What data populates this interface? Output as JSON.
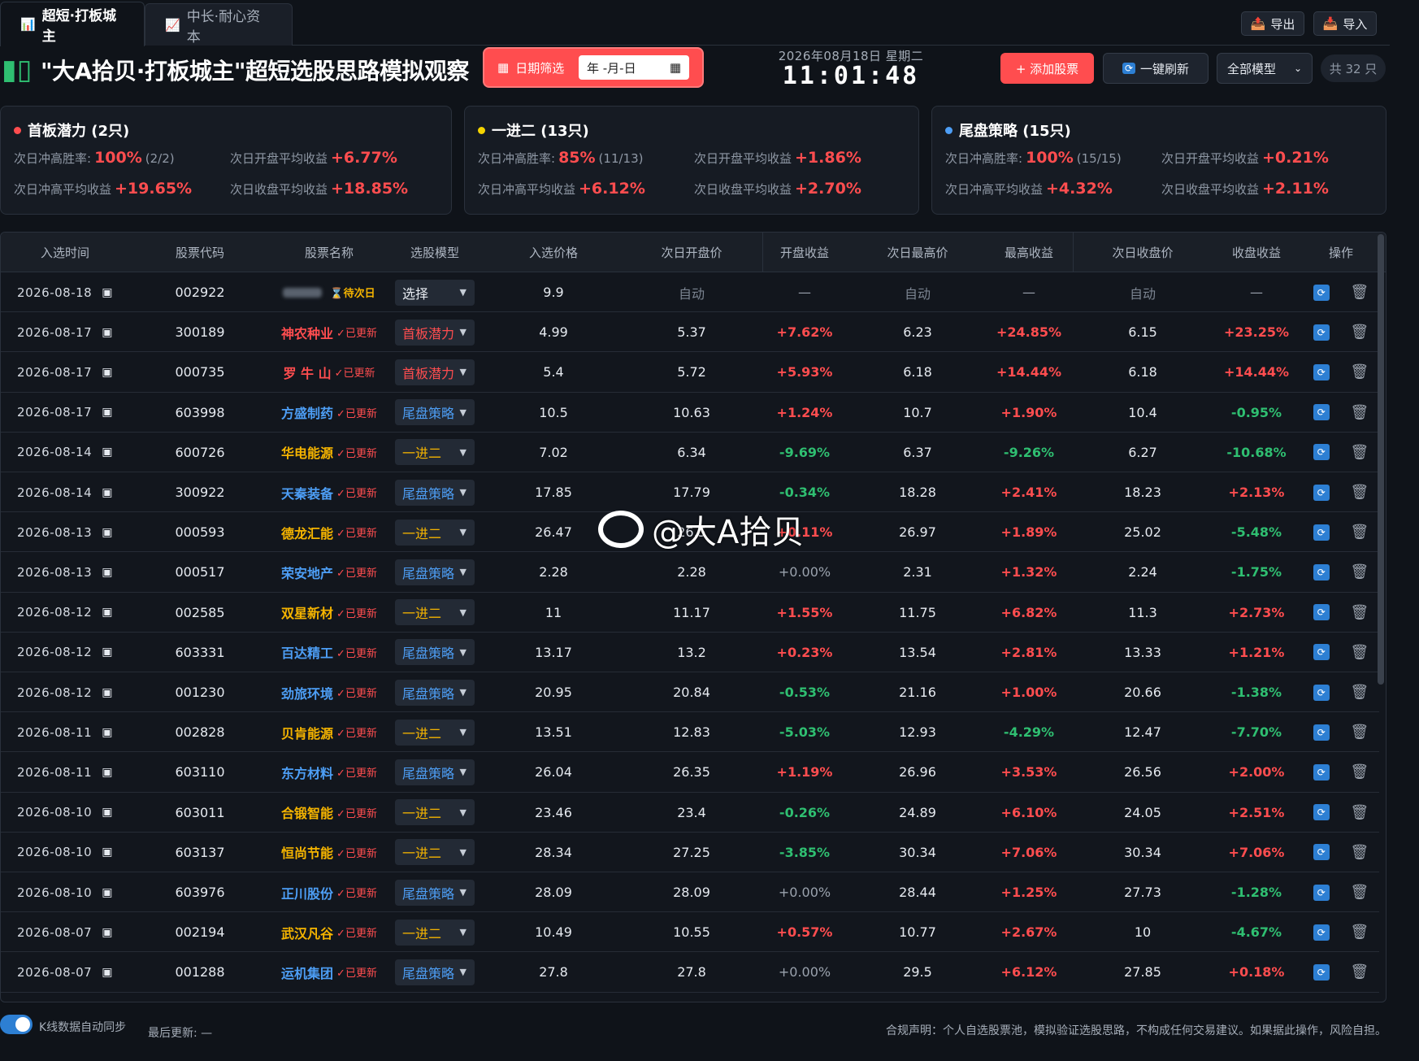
{
  "tabs": {
    "active": "超短·打板城主",
    "inactive": "中长·耐心资本"
  },
  "header_buttons": {
    "export": "导出",
    "import": "导入"
  },
  "page_title": "\"大A拾贝·打板城主\"超短选股思路模拟观察",
  "date_filter": {
    "label": "日期筛选",
    "value": "年 -月-日"
  },
  "clock": {
    "date": "2026年08月18日 星期二",
    "time": "11:01:48"
  },
  "actions": {
    "add": "+ 添加股票",
    "refresh": "一键刷新",
    "model_select": "全部模型",
    "count": "共 32 只"
  },
  "cards": [
    {
      "title": "首板潜力 (2只)",
      "color": "#ff4d4f",
      "rate_label": "次日冲高胜率:",
      "rate": "100%",
      "rate_sub": "(2/2)",
      "open_label": "次日开盘平均收益",
      "open": "+6.77%",
      "high_label": "次日冲高平均收益",
      "high": "+19.65%",
      "close_label": "次日收盘平均收益",
      "close": "+18.85%"
    },
    {
      "title": "一进二 (13只)",
      "color": "#f5d400",
      "rate_label": "次日冲高胜率:",
      "rate": "85%",
      "rate_sub": "(11/13)",
      "open_label": "次日开盘平均收益",
      "open": "+1.86%",
      "high_label": "次日冲高平均收益",
      "high": "+6.12%",
      "close_label": "次日收盘平均收益",
      "close": "+2.70%"
    },
    {
      "title": "尾盘策略 (15只)",
      "color": "#4d9ef5",
      "rate_label": "次日冲高胜率:",
      "rate": "100%",
      "rate_sub": "(15/15)",
      "open_label": "次日开盘平均收益",
      "open": "+0.21%",
      "high_label": "次日冲高平均收益",
      "high": "+4.32%",
      "close_label": "次日收盘平均收益",
      "close": "+2.11%"
    }
  ],
  "table": {
    "headers": [
      "入选时间",
      "股票代码",
      "股票名称",
      "选股模型",
      "入选价格",
      "次日开盘价",
      "开盘收益",
      "次日最高价",
      "最高收益",
      "次日收盘价",
      "收盘收益",
      "操作"
    ],
    "rows": [
      {
        "date": "2026-08-18",
        "code": "002922",
        "name": "",
        "status": "⌛待次日",
        "model": "选择",
        "price": "9.9",
        "open": "自动",
        "open_ret": "—",
        "high": "自动",
        "high_ret": "—",
        "close": "自动",
        "close_ret": "—"
      },
      {
        "date": "2026-08-17",
        "code": "300189",
        "name": "神农种业",
        "status": "✓已更新",
        "model": "首板潜力",
        "price": "4.99",
        "open": "5.37",
        "open_ret": "+7.62%",
        "high": "6.23",
        "high_ret": "+24.85%",
        "close": "6.15",
        "close_ret": "+23.25%"
      },
      {
        "date": "2026-08-17",
        "code": "000735",
        "name": "罗 牛 山",
        "status": "✓已更新",
        "model": "首板潜力",
        "price": "5.4",
        "open": "5.72",
        "open_ret": "+5.93%",
        "high": "6.18",
        "high_ret": "+14.44%",
        "close": "6.18",
        "close_ret": "+14.44%"
      },
      {
        "date": "2026-08-17",
        "code": "603998",
        "name": "方盛制药",
        "status": "✓已更新",
        "model": "尾盘策略",
        "price": "10.5",
        "open": "10.63",
        "open_ret": "+1.24%",
        "high": "10.7",
        "high_ret": "+1.90%",
        "close": "10.4",
        "close_ret": "-0.95%"
      },
      {
        "date": "2026-08-14",
        "code": "600726",
        "name": "华电能源",
        "status": "✓已更新",
        "model": "一进二",
        "price": "7.02",
        "open": "6.34",
        "open_ret": "-9.69%",
        "high": "6.37",
        "high_ret": "-9.26%",
        "close": "6.27",
        "close_ret": "-10.68%"
      },
      {
        "date": "2026-08-14",
        "code": "300922",
        "name": "天秦装备",
        "status": "✓已更新",
        "model": "尾盘策略",
        "price": "17.85",
        "open": "17.79",
        "open_ret": "-0.34%",
        "high": "18.28",
        "high_ret": "+2.41%",
        "close": "18.23",
        "close_ret": "+2.13%"
      },
      {
        "date": "2026-08-13",
        "code": "000593",
        "name": "德龙汇能",
        "status": "✓已更新",
        "model": "一进二",
        "price": "26.47",
        "open": "26.5",
        "open_ret": "+0.11%",
        "high": "26.97",
        "high_ret": "+1.89%",
        "close": "25.02",
        "close_ret": "-5.48%"
      },
      {
        "date": "2026-08-13",
        "code": "000517",
        "name": "荣安地产",
        "status": "✓已更新",
        "model": "尾盘策略",
        "price": "2.28",
        "open": "2.28",
        "open_ret": "+0.00%",
        "high": "2.31",
        "high_ret": "+1.32%",
        "close": "2.24",
        "close_ret": "-1.75%"
      },
      {
        "date": "2026-08-12",
        "code": "002585",
        "name": "双星新材",
        "status": "✓已更新",
        "model": "一进二",
        "price": "11",
        "open": "11.17",
        "open_ret": "+1.55%",
        "high": "11.75",
        "high_ret": "+6.82%",
        "close": "11.3",
        "close_ret": "+2.73%"
      },
      {
        "date": "2026-08-12",
        "code": "603331",
        "name": "百达精工",
        "status": "✓已更新",
        "model": "尾盘策略",
        "price": "13.17",
        "open": "13.2",
        "open_ret": "+0.23%",
        "high": "13.54",
        "high_ret": "+2.81%",
        "close": "13.33",
        "close_ret": "+1.21%"
      },
      {
        "date": "2026-08-12",
        "code": "001230",
        "name": "劲旅环境",
        "status": "✓已更新",
        "model": "尾盘策略",
        "price": "20.95",
        "open": "20.84",
        "open_ret": "-0.53%",
        "high": "21.16",
        "high_ret": "+1.00%",
        "close": "20.66",
        "close_ret": "-1.38%"
      },
      {
        "date": "2026-08-11",
        "code": "002828",
        "name": "贝肯能源",
        "status": "✓已更新",
        "model": "一进二",
        "price": "13.51",
        "open": "12.83",
        "open_ret": "-5.03%",
        "high": "12.93",
        "high_ret": "-4.29%",
        "close": "12.47",
        "close_ret": "-7.70%"
      },
      {
        "date": "2026-08-11",
        "code": "603110",
        "name": "东方材料",
        "status": "✓已更新",
        "model": "尾盘策略",
        "price": "26.04",
        "open": "26.35",
        "open_ret": "+1.19%",
        "high": "26.96",
        "high_ret": "+3.53%",
        "close": "26.56",
        "close_ret": "+2.00%"
      },
      {
        "date": "2026-08-10",
        "code": "603011",
        "name": "合锻智能",
        "status": "✓已更新",
        "model": "一进二",
        "price": "23.46",
        "open": "23.4",
        "open_ret": "-0.26%",
        "high": "24.89",
        "high_ret": "+6.10%",
        "close": "24.05",
        "close_ret": "+2.51%"
      },
      {
        "date": "2026-08-10",
        "code": "603137",
        "name": "恒尚节能",
        "status": "✓已更新",
        "model": "一进二",
        "price": "28.34",
        "open": "27.25",
        "open_ret": "-3.85%",
        "high": "30.34",
        "high_ret": "+7.06%",
        "close": "30.34",
        "close_ret": "+7.06%"
      },
      {
        "date": "2026-08-10",
        "code": "603976",
        "name": "正川股份",
        "status": "✓已更新",
        "model": "尾盘策略",
        "price": "28.09",
        "open": "28.09",
        "open_ret": "+0.00%",
        "high": "28.44",
        "high_ret": "+1.25%",
        "close": "27.73",
        "close_ret": "-1.28%"
      },
      {
        "date": "2026-08-07",
        "code": "002194",
        "name": "武汉凡谷",
        "status": "✓已更新",
        "model": "一进二",
        "price": "10.49",
        "open": "10.55",
        "open_ret": "+0.57%",
        "high": "10.77",
        "high_ret": "+2.67%",
        "close": "10",
        "close_ret": "-4.67%"
      },
      {
        "date": "2026-08-07",
        "code": "001288",
        "name": "运机集团",
        "status": "✓已更新",
        "model": "尾盘策略",
        "price": "27.8",
        "open": "27.8",
        "open_ret": "+0.00%",
        "high": "29.5",
        "high_ret": "+6.12%",
        "close": "27.85",
        "close_ret": "+0.18%"
      }
    ]
  },
  "footer": {
    "sync_label": "K线数据自动同步",
    "last_update": "最后更新: —",
    "disclaimer": "合规声明：个人自选股票池，模拟验证选股思路，不构成任何交易建议。如果据此操作，风险自担。"
  },
  "watermark": "@大A拾贝"
}
